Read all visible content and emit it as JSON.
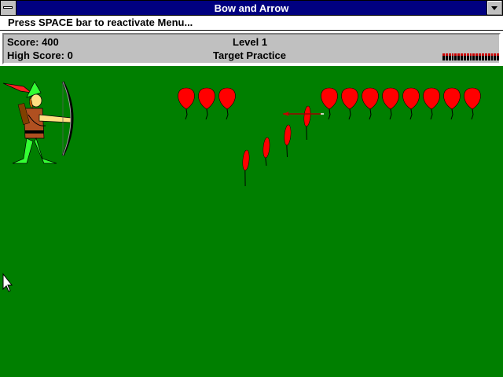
{
  "window": {
    "title": "Bow and Arrow"
  },
  "message": "Press SPACE bar to reactivate Menu...",
  "status": {
    "score_label": "Score: 400",
    "high_score_label": "High Score: 0",
    "level_label": "Level 1",
    "mode_label": "Target Practice",
    "arrows_remaining": 19
  },
  "colors": {
    "field": "#007f00",
    "balloon": "#ff0000",
    "titlebar": "#000080"
  },
  "icons": [
    "system-menu-icon",
    "minimize-icon",
    "archer-sprite",
    "balloon-icon",
    "arrow-icon",
    "mouse-cursor-icon"
  ]
}
